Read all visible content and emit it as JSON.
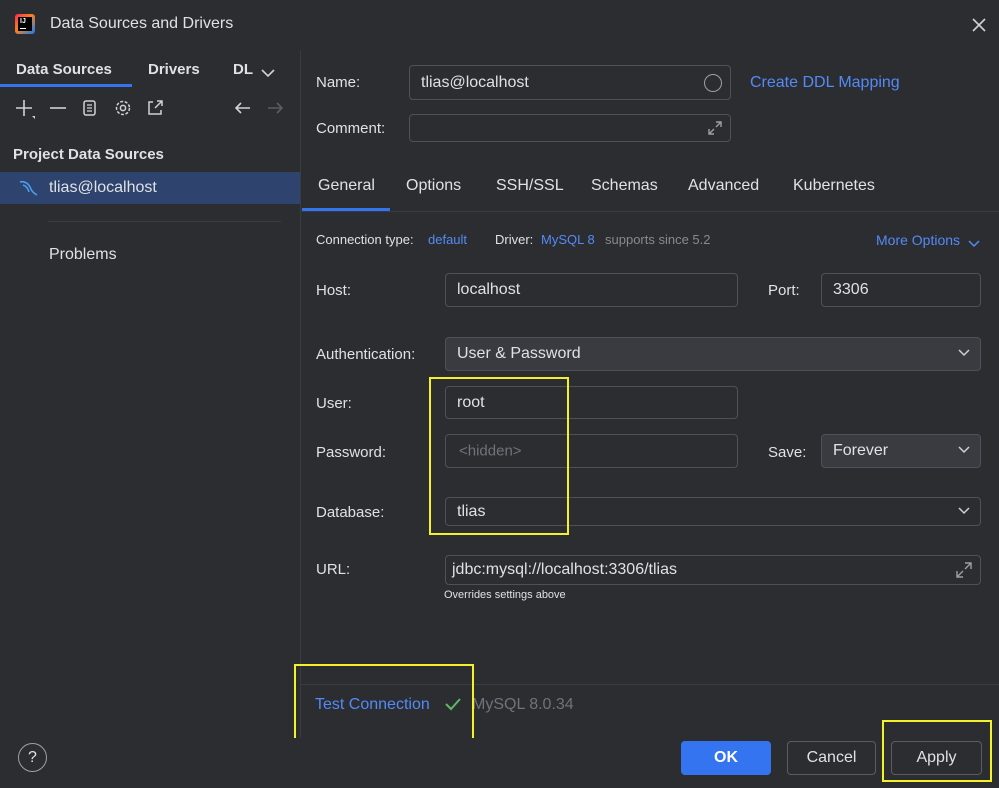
{
  "window": {
    "title": "Data Sources and Drivers",
    "logo_text": "IJ"
  },
  "left": {
    "tabs": [
      "Data Sources",
      "Drivers",
      "DL"
    ],
    "section_title": "Project Data Sources",
    "selected_item": "tlias@localhost",
    "problems": "Problems"
  },
  "form": {
    "name_label": "Name:",
    "name_value": "tlias@localhost",
    "create_ddl": "Create DDL Mapping",
    "comment_label": "Comment:",
    "comment_value": "",
    "tabs": [
      "General",
      "Options",
      "SSH/SSL",
      "Schemas",
      "Advanced",
      "Kubernetes"
    ],
    "connection_type_label": "Connection type:",
    "connection_type_value": "default",
    "driver_label": "Driver:",
    "driver_value": "MySQL 8",
    "driver_note": "supports since 5.2",
    "more_options": "More Options",
    "host_label": "Host:",
    "host_value": "localhost",
    "port_label": "Port:",
    "port_value": "3306",
    "auth_label": "Authentication:",
    "auth_value": "User & Password",
    "user_label": "User:",
    "user_value": "root",
    "password_label": "Password:",
    "password_placeholder": "<hidden>",
    "save_label": "Save:",
    "save_value": "Forever",
    "database_label": "Database:",
    "database_value": "tlias",
    "url_label": "URL:",
    "url_value": "jdbc:mysql://localhost:3306/tlias",
    "url_note": "Overrides settings above"
  },
  "status": {
    "test_connection": "Test Connection",
    "result": "MySQL 8.0.34"
  },
  "footer": {
    "help": "?",
    "ok": "OK",
    "cancel": "Cancel",
    "apply": "Apply"
  },
  "colors": {
    "accent": "#3574f0",
    "link": "#548af7",
    "selection": "#2e436e",
    "highlight": "#f4f02a",
    "success": "#5fb865"
  }
}
